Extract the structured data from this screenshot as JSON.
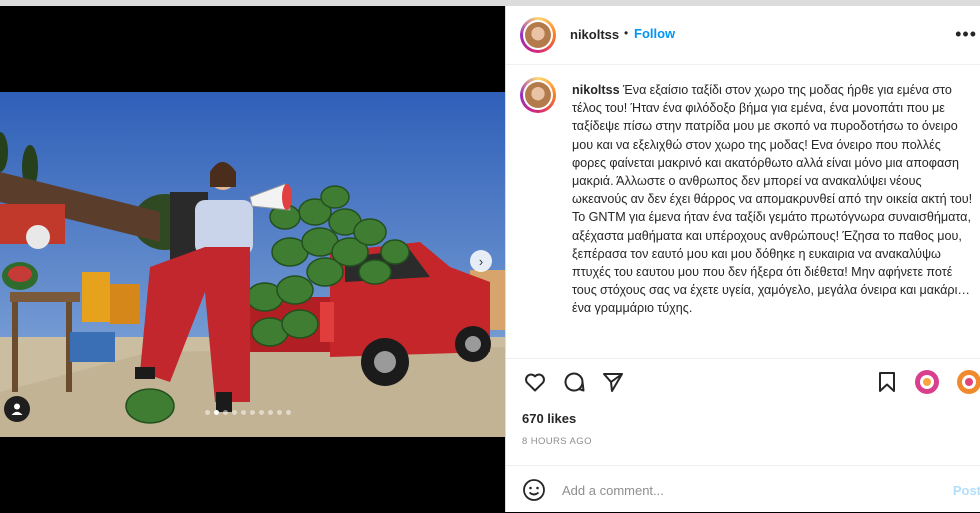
{
  "post": {
    "username": "nikoltss",
    "follow_separator": "•",
    "follow_label": "Follow",
    "more_label": "•••",
    "caption": "Ένα εξαίσιο ταξίδι στον χωρο της μοδας ήρθε για εμένα στο τέλος του! Ήταν ένα φιλόδοξο βήμα για εμένα, ένα μονοπάτι που με ταξίδεψε πίσω στην πατρίδα μου με σκοπό να πυροδοτήσω το όνειρο μου και να εξελιχθώ στον χωρο της μοδας! Ενα όνειρο που πολλές φορες φαίνεται μακρινό και ακατόρθωτο αλλά είναι μόνο μια αποφαση μακριά. Άλλωστε ο ανθρωπος δεν μπορεί να ανακαλύψει νέους ωκεανούς αν δεν έχει θάρρος να απομακρυνθεί από την οικεία ακτή του! Το GNTM για έμενα ήταν ένα ταξίδι γεμάτο πρωτόγνωρα συναισθήματα, αξέχαστα μαθήματα και υπέροχους ανθρώπους! Έζησα το παθος μου, ξεπέρασα τον εαυτό μου και μου δόθηκε η ευκαιρια να ανακαλύψω πτυχές του εαυτου μου που δεν ήξερα ότι διέθετα! Μην αφήνετε ποτέ τους στόχους σας να έχετε υγεία, χαμόγελο, μεγάλα όνειρα και μακάρι… ένα γραμμάριο τύχης.",
    "likes": "670 likes",
    "time": "8 HOURS AGO",
    "comment_placeholder": "Add a comment...",
    "post_label": "Post"
  },
  "media": {
    "next_arrow": "›",
    "carousel_total": 10,
    "carousel_active": 2
  },
  "icons": {
    "like": "heart-icon",
    "comment": "speech-bubble-icon",
    "share": "paper-plane-icon",
    "save": "bookmark-icon",
    "emoji": "smiley-icon",
    "user_tag": "person-icon"
  },
  "colors": {
    "follow": "#0095f6",
    "text": "#262626",
    "muted": "#8e8e8e",
    "post_disabled": "#b2dffc"
  }
}
